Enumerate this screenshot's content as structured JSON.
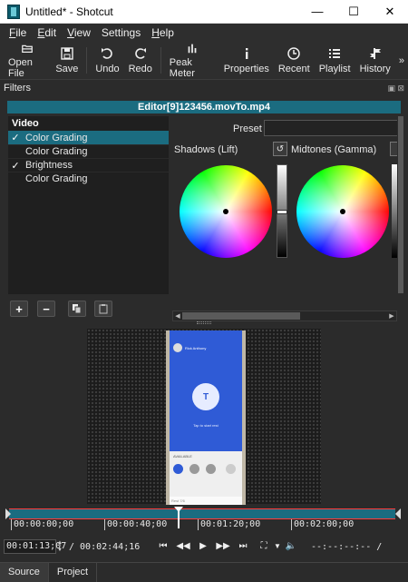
{
  "window": {
    "title": "Untitled* - Shotcut",
    "minimize": "—",
    "maximize": "☐",
    "close": "✕"
  },
  "menu": [
    {
      "label_u": "F",
      "label_rest": "ile"
    },
    {
      "label_u": "E",
      "label_rest": "dit"
    },
    {
      "label_u": "V",
      "label_rest": "iew"
    },
    {
      "label_u": "",
      "label_rest": "Settings"
    },
    {
      "label_u": "H",
      "label_rest": "elp"
    }
  ],
  "toolbar": {
    "open_file": "Open File",
    "save": "Save",
    "undo": "Undo",
    "redo": "Redo",
    "peak_meter": "Peak Meter",
    "properties": "Properties",
    "recent": "Recent",
    "playlist": "Playlist",
    "history": "History",
    "more": "»"
  },
  "filters": {
    "dock_title": "Filters",
    "clip_name": "Editor[9]123456.movTo.mp4",
    "list_header": "Video",
    "items": [
      {
        "label": "Color Grading",
        "checked": "✓"
      },
      {
        "label": "Color Grading",
        "checked": ""
      },
      {
        "label": "Brightness",
        "checked": "✓"
      },
      {
        "label": "Color Grading",
        "checked": ""
      }
    ],
    "preset_label": "Preset",
    "preset_value": "",
    "shadows_label": "Shadows (Lift)",
    "midtones_label": "Midtones (Gamma)",
    "add": "+",
    "remove": "−"
  },
  "phone": {
    "contact": "Rick Anthony",
    "caption": "Tap to start rest",
    "section": "AVAILABLE",
    "footer": "Rest 7/6"
  },
  "timeline": {
    "ticks": [
      "00:00:00;00",
      "00:00:40;00",
      "00:01:20;00",
      "00:02:00;00"
    ],
    "position": "00:01:13;07",
    "duration": "/ 00:02:44;16",
    "inout": "--:--:--:-- /"
  },
  "tabs": {
    "source": "Source",
    "project": "Project"
  },
  "colors": {
    "accent": "#1b6c80",
    "background": "#2b2b2b",
    "marker": "#ff3a3a"
  }
}
